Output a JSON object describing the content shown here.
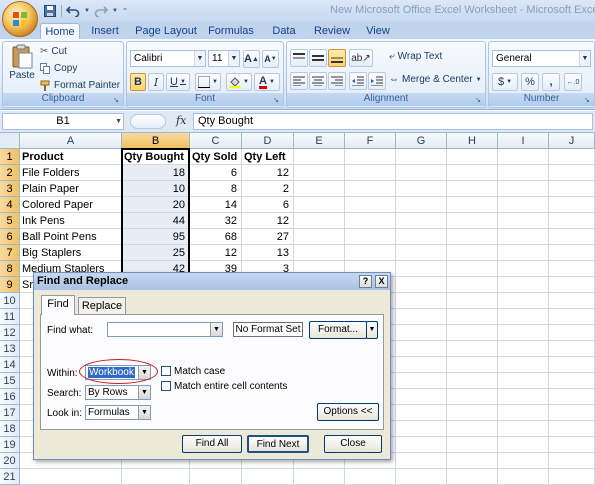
{
  "window": {
    "title": "New Microsoft Office Excel Worksheet - Microsoft Excel"
  },
  "qat": {
    "save": "save-icon",
    "undo": "undo-icon",
    "redo": "redo-icon"
  },
  "tabs": [
    "Home",
    "Insert",
    "Page Layout",
    "Formulas",
    "Data",
    "Review",
    "View"
  ],
  "ribbon": {
    "clipboard": {
      "label": "Clipboard",
      "paste": "Paste",
      "cut": "Cut",
      "copy": "Copy",
      "format_painter": "Format Painter"
    },
    "font": {
      "label": "Font",
      "name": "Calibri",
      "size": "11",
      "bold": "B",
      "italic": "I",
      "underline": "U"
    },
    "alignment": {
      "label": "Alignment",
      "wrap_text": "Wrap Text",
      "merge_center": "Merge & Center"
    },
    "number": {
      "label": "Number",
      "format": "General",
      "currency": "$",
      "percent": "%",
      "comma": ","
    }
  },
  "formula_bar": {
    "name_box": "B1",
    "fx": "fx",
    "value": "Qty Bought"
  },
  "grid": {
    "columns": [
      "A",
      "B",
      "C",
      "D",
      "E",
      "F",
      "G",
      "H",
      "I",
      "J"
    ],
    "rows": [
      "1",
      "2",
      "3",
      "4",
      "5",
      "6",
      "7",
      "8",
      "9",
      "10",
      "11",
      "12",
      "13",
      "14",
      "15",
      "16",
      "17",
      "18",
      "19",
      "20",
      "21"
    ],
    "headers": [
      "Product",
      "Qty Bought",
      "Qty Sold",
      "Qty Left"
    ],
    "data": [
      [
        "File Folders",
        "18",
        "6",
        "12"
      ],
      [
        "Plain Paper",
        "10",
        "8",
        "2"
      ],
      [
        "Colored Paper",
        "20",
        "14",
        "6"
      ],
      [
        "Ink Pens",
        "44",
        "32",
        "12"
      ],
      [
        "Ball Point Pens",
        "95",
        "68",
        "27"
      ],
      [
        "Big Staplers",
        "25",
        "12",
        "13"
      ],
      [
        "Medium Staplers",
        "42",
        "39",
        "3"
      ],
      [
        "Sr",
        "",
        "",
        ""
      ]
    ]
  },
  "dialog": {
    "title": "Find and Replace",
    "help": "?",
    "close": "X",
    "tabs": [
      "Find",
      "Replace"
    ],
    "find_what_label": "Find what:",
    "find_what_value": "",
    "no_format_set": "No Format Set",
    "format_button": "Format...",
    "within_label": "Within:",
    "within_value": "Workbook",
    "search_label": "Search:",
    "search_value": "By Rows",
    "look_in_label": "Look in:",
    "look_in_value": "Formulas",
    "match_case": "Match case",
    "match_entire": "Match entire cell contents",
    "options_button": "Options <<",
    "find_all": "Find All",
    "find_next": "Find Next",
    "close_button": "Close",
    "highlight_color": "#d01a1a"
  }
}
